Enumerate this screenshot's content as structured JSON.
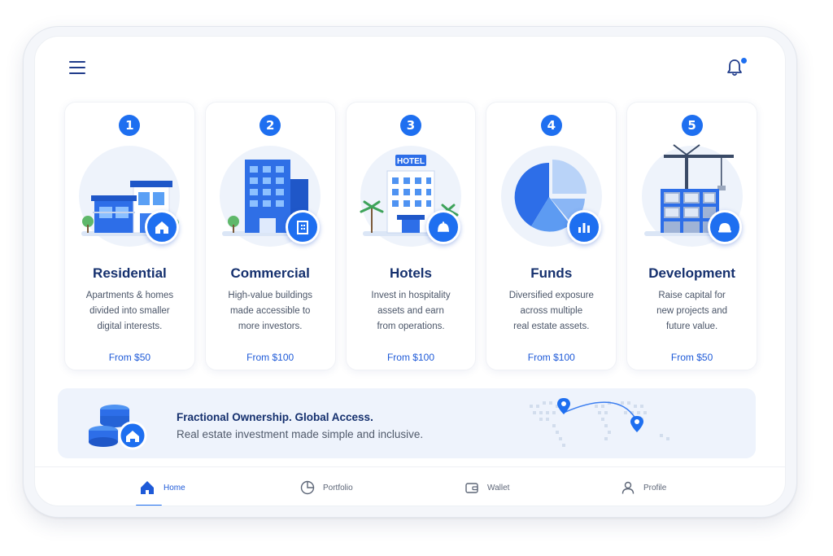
{
  "header": {
    "menu_icon": "hamburger-icon",
    "notification_icon": "bell-icon"
  },
  "categories": [
    {
      "number": "1",
      "title": "Residential",
      "desc": [
        "Apartments & homes",
        "divided into smaller",
        "digital interests."
      ],
      "price": "From $50",
      "badge_icon": "home-icon"
    },
    {
      "number": "2",
      "title": "Commercial",
      "desc": [
        "High-value buildings",
        "made accessible to",
        "more investors."
      ],
      "price": "From $100",
      "badge_icon": "building-icon"
    },
    {
      "number": "3",
      "title": "Hotels",
      "desc": [
        "Invest in hospitality",
        "assets and earn",
        "from operations."
      ],
      "price": "From $100",
      "badge_icon": "bell-service-icon",
      "sign": "HOTEL"
    },
    {
      "number": "4",
      "title": "Funds",
      "desc": [
        "Diversified exposure",
        "across multiple",
        "real estate assets."
      ],
      "price": "From $100",
      "badge_icon": "bar-chart-icon"
    },
    {
      "number": "5",
      "title": "Development",
      "desc": [
        "Raise capital for",
        "new projects and",
        "future value."
      ],
      "price": "From $50",
      "badge_icon": "hard-hat-icon"
    }
  ],
  "banner": {
    "title": "Fractional Ownership. Global Access.",
    "subtitle": "Real estate investment made simple and inclusive."
  },
  "nav": [
    {
      "label": "Home",
      "icon": "home-icon",
      "active": true
    },
    {
      "label": "Portfolio",
      "icon": "pie-chart-icon",
      "active": false
    },
    {
      "label": "Wallet",
      "icon": "wallet-icon",
      "active": false
    },
    {
      "label": "Profile",
      "icon": "user-icon",
      "active": false
    }
  ],
  "colors": {
    "accent": "#1e6ff0",
    "title": "#15306e",
    "price": "#1e5ad8"
  }
}
